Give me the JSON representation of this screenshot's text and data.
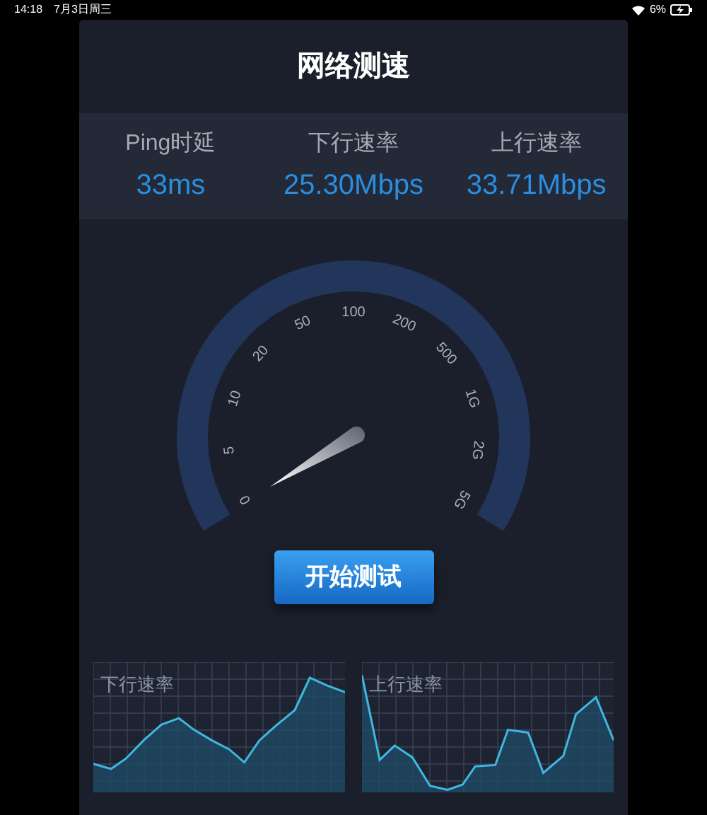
{
  "status_bar": {
    "time": "14:18",
    "date": "7月3日周三",
    "battery": "6%"
  },
  "title": "网络测速",
  "stats": [
    {
      "label": "Ping时延",
      "value": "33ms"
    },
    {
      "label": "下行速率",
      "value": "25.30Mbps"
    },
    {
      "label": "上行速率",
      "value": "33.71Mbps"
    }
  ],
  "gauge": {
    "labels": [
      "0",
      "5",
      "10",
      "20",
      "50",
      "100",
      "200",
      "500",
      "1G",
      "2G",
      "5G"
    ]
  },
  "start_button": "开始测试",
  "graphs": [
    {
      "label": "下行速率",
      "kind": "download"
    },
    {
      "label": "上行速率",
      "kind": "upload"
    }
  ]
}
